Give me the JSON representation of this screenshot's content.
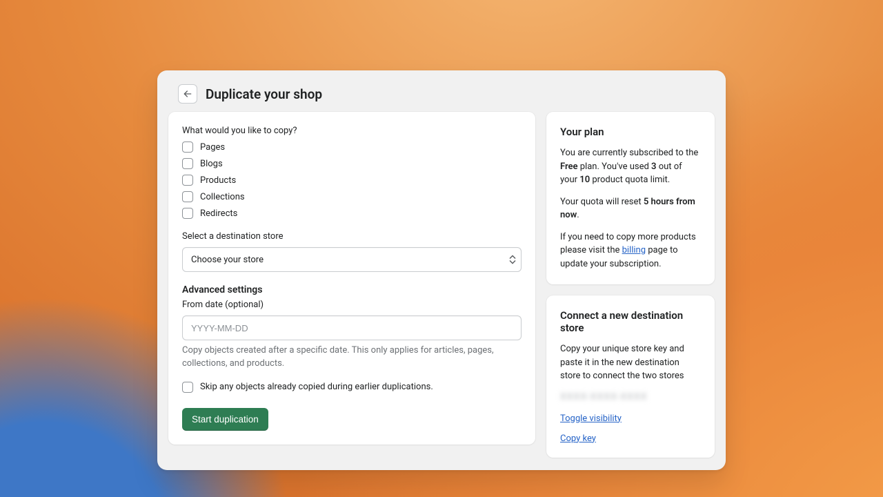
{
  "header": {
    "title": "Duplicate your shop"
  },
  "copy": {
    "prompt": "What would you like to copy?",
    "items": [
      "Pages",
      "Blogs",
      "Products",
      "Collections",
      "Redirects"
    ]
  },
  "destination": {
    "label": "Select a destination store",
    "placeholder": "Choose your store"
  },
  "advanced": {
    "heading": "Advanced settings",
    "from_label": "From date (optional)",
    "from_placeholder": "YYYY-MM-DD",
    "from_help": "Copy objects created after a specific date. This only applies for articles, pages, collections, and products.",
    "skip_label": "Skip any objects already copied during earlier duplications."
  },
  "actions": {
    "start": "Start duplication"
  },
  "plan": {
    "heading": "Your plan",
    "p1_a": "You are currently subscribed to the ",
    "p1_plan": "Free",
    "p1_b": " plan. You've used ",
    "p1_used": "3",
    "p1_c": " out of your ",
    "p1_total": "10",
    "p1_d": " product quota limit.",
    "p2_a": "Your quota will reset ",
    "p2_time": "5 hours from now",
    "p2_b": ".",
    "p3_a": "If you need to copy more products please visit the ",
    "p3_link": "billing",
    "p3_b": " page to update your subscription."
  },
  "connect": {
    "heading": "Connect a new destination store",
    "body": "Copy your unique store key and paste it in the new destination store to connect the two stores",
    "masked_key": "XXXX-XXXX-XXXX",
    "toggle": "Toggle visibility",
    "copy": "Copy key"
  }
}
